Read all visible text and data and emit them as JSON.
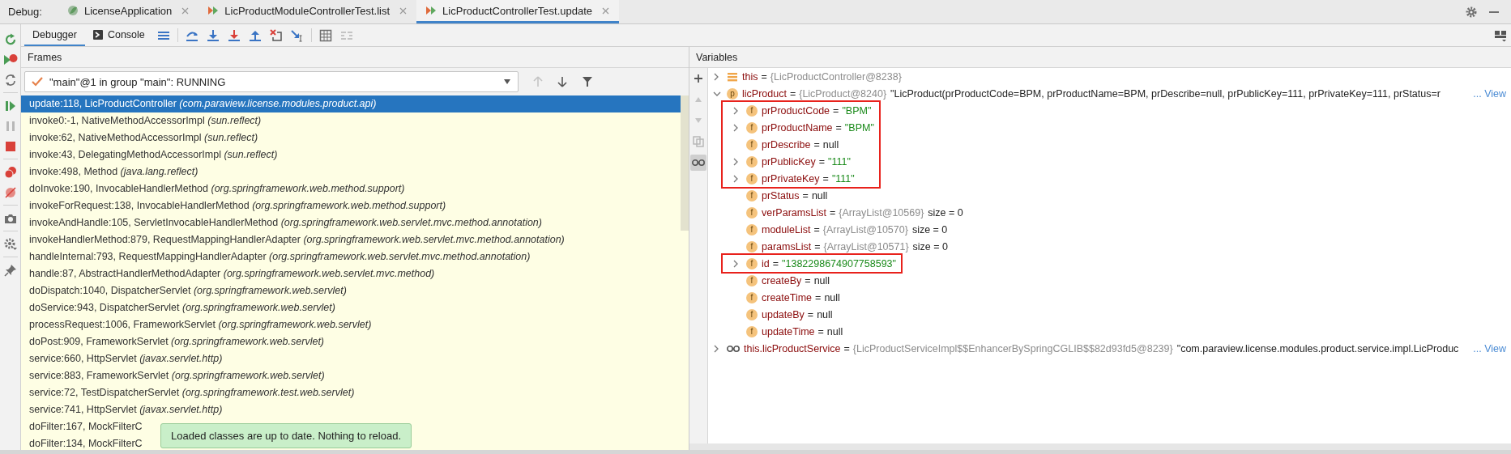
{
  "debug_bar": {
    "label": "Debug:",
    "tabs": [
      {
        "label": "LicenseApplication",
        "kind": "app",
        "selected": false
      },
      {
        "label": "LicProductModuleControllerTest.list",
        "kind": "test",
        "selected": false
      },
      {
        "label": "LicProductControllerTest.update",
        "kind": "test",
        "selected": true
      }
    ]
  },
  "toolbar": {
    "tabs": [
      {
        "label": "Debugger",
        "kind": "plain",
        "selected": true
      },
      {
        "label": "Console",
        "kind": "console",
        "selected": false
      }
    ]
  },
  "frames": {
    "title": "Frames",
    "thread": {
      "label": "\"main\"@1 in group \"main\": RUNNING"
    },
    "rows": [
      {
        "label": "update:118, LicProductController *(com.paraview.license.modules.product.api)*",
        "selected": true
      },
      {
        "label": "invoke0:-1, NativeMethodAccessorImpl *(sun.reflect)*",
        "selected": false
      },
      {
        "label": "invoke:62, NativeMethodAccessorImpl *(sun.reflect)*",
        "selected": false
      },
      {
        "label": "invoke:43, DelegatingMethodAccessorImpl *(sun.reflect)*",
        "selected": false
      },
      {
        "label": "invoke:498, Method *(java.lang.reflect)*",
        "selected": false
      },
      {
        "label": "doInvoke:190, InvocableHandlerMethod *(org.springframework.web.method.support)*",
        "selected": false
      },
      {
        "label": "invokeForRequest:138, InvocableHandlerMethod *(org.springframework.web.method.support)*",
        "selected": false
      },
      {
        "label": "invokeAndHandle:105, ServletInvocableHandlerMethod *(org.springframework.web.servlet.mvc.method.annotation)*",
        "selected": false
      },
      {
        "label": "invokeHandlerMethod:879, RequestMappingHandlerAdapter *(org.springframework.web.servlet.mvc.method.annotation)*",
        "selected": false
      },
      {
        "label": "handleInternal:793, RequestMappingHandlerAdapter *(org.springframework.web.servlet.mvc.method.annotation)*",
        "selected": false
      },
      {
        "label": "handle:87, AbstractHandlerMethodAdapter *(org.springframework.web.servlet.mvc.method)*",
        "selected": false
      },
      {
        "label": "doDispatch:1040, DispatcherServlet *(org.springframework.web.servlet)*",
        "selected": false
      },
      {
        "label": "doService:943, DispatcherServlet *(org.springframework.web.servlet)*",
        "selected": false
      },
      {
        "label": "processRequest:1006, FrameworkServlet *(org.springframework.web.servlet)*",
        "selected": false
      },
      {
        "label": "doPost:909, FrameworkServlet *(org.springframework.web.servlet)*",
        "selected": false
      },
      {
        "label": "service:660, HttpServlet *(javax.servlet.http)*",
        "selected": false
      },
      {
        "label": "service:883, FrameworkServlet *(org.springframework.web.servlet)*",
        "selected": false
      },
      {
        "label": "service:72, TestDispatcherServlet *(org.springframework.test.web.servlet)*",
        "selected": false
      },
      {
        "label": "service:741, HttpServlet *(javax.servlet.http)*",
        "selected": false
      },
      {
        "label": "doFilter:167, MockFilterC",
        "selected": false
      },
      {
        "label": "doFilter:134, MockFilterC",
        "selected": false
      }
    ]
  },
  "variables": {
    "title": "Variables",
    "items": [
      {
        "name": "this",
        "op": "=",
        "kind": "list",
        "expanded": false,
        "ref": "{LicProductController@8238}"
      },
      {
        "name": "licProduct",
        "op": "=",
        "kind": "badge",
        "badge": "p",
        "expanded": true,
        "ref": "{LicProduct@8240}",
        "value": {
          "kind": "plain",
          "text": "\"LicProduct(prProductCode=BPM, prProductName=BPM, prDescribe=null, prPublicKey=111, prPrivateKey=111, prStatus=r"
        },
        "link": "... View",
        "children": [
          {
            "name": "prProductCode",
            "op": "=",
            "kind": "badge",
            "badge": "f",
            "expanded": false,
            "value": {
              "kind": "string",
              "text": "\"BPM\""
            },
            "highlighted": true
          },
          {
            "name": "prProductName",
            "op": "=",
            "kind": "badge",
            "badge": "f",
            "expanded": false,
            "value": {
              "kind": "string",
              "text": "\"BPM\""
            },
            "highlighted": true
          },
          {
            "name": "prDescribe",
            "op": "=",
            "kind": "badge",
            "badge": "f",
            "value": {
              "kind": "plain",
              "text": "null"
            },
            "highlighted": true
          },
          {
            "name": "prPublicKey",
            "op": "=",
            "kind": "badge",
            "badge": "f",
            "expanded": false,
            "value": {
              "kind": "string",
              "text": "\"111\""
            },
            "highlighted": true
          },
          {
            "name": "prPrivateKey",
            "op": "=",
            "kind": "badge",
            "badge": "f",
            "expanded": false,
            "value": {
              "kind": "string",
              "text": "\"111\""
            },
            "highlighted": true
          },
          {
            "name": "prStatus",
            "op": "=",
            "kind": "badge",
            "badge": "f",
            "value": {
              "kind": "plain",
              "text": "null"
            }
          },
          {
            "name": "verParamsList",
            "op": "=",
            "kind": "badge",
            "badge": "f",
            "ref": "{ArrayList@10569}",
            "value": {
              "kind": "plain",
              "text": "size = 0"
            }
          },
          {
            "name": "moduleList",
            "op": "=",
            "kind": "badge",
            "badge": "f",
            "ref": "{ArrayList@10570}",
            "value": {
              "kind": "plain",
              "text": "size = 0"
            }
          },
          {
            "name": "paramsList",
            "op": "=",
            "kind": "badge",
            "badge": "f",
            "ref": "{ArrayList@10571}",
            "value": {
              "kind": "plain",
              "text": "size = 0"
            }
          },
          {
            "name": "id",
            "op": "=",
            "kind": "badge",
            "badge": "f",
            "expanded": false,
            "value": {
              "kind": "string",
              "text": "\"1382298674907758593\""
            },
            "highlighted": true
          },
          {
            "name": "createBy",
            "op": "=",
            "kind": "badge",
            "badge": "f",
            "value": {
              "kind": "plain",
              "text": "null"
            }
          },
          {
            "name": "createTime",
            "op": "=",
            "kind": "badge",
            "badge": "f",
            "value": {
              "kind": "plain",
              "text": "null"
            }
          },
          {
            "name": "updateBy",
            "op": "=",
            "kind": "badge",
            "badge": "f",
            "value": {
              "kind": "plain",
              "text": "null"
            }
          },
          {
            "name": "updateTime",
            "op": "=",
            "kind": "badge",
            "badge": "f",
            "value": {
              "kind": "plain",
              "text": "null"
            }
          }
        ]
      },
      {
        "name": "this.licProductService",
        "op": "=",
        "kind": "watch",
        "expanded": false,
        "ref": "{LicProductServiceImpl$$EnhancerBySpringCGLIB$$82d93fd5@8239}",
        "value": {
          "kind": "plain",
          "text": "\"com.paraview.license.modules.product.service.impl.LicProduc"
        },
        "link": "... View"
      }
    ]
  },
  "notification": {
    "text": "Loaded classes are up to date. Nothing to reload."
  }
}
